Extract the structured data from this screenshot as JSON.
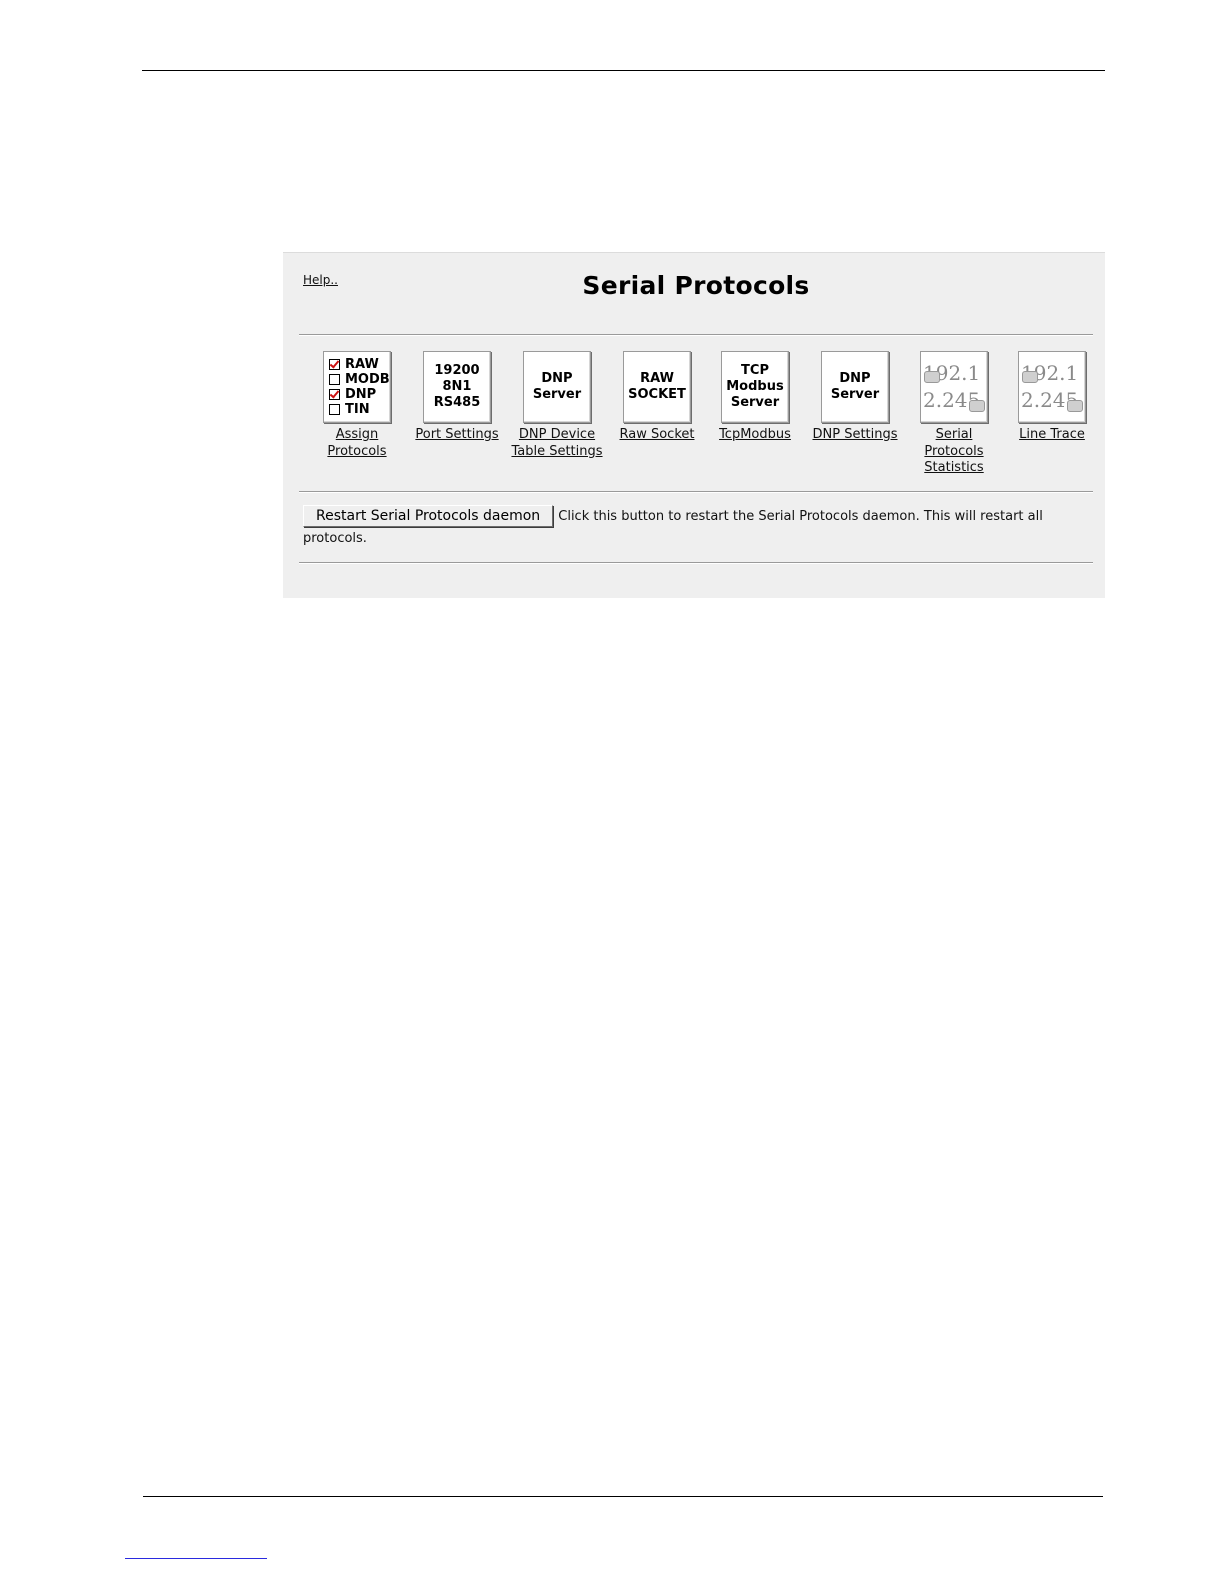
{
  "page": {
    "panel_title": "Serial Protocols",
    "help_link": "Help.."
  },
  "tiles": [
    {
      "id": "assign-protocols",
      "label": "Assign Protocols",
      "icon": "protocol-checklist-icon",
      "protocols": [
        {
          "name": "RAW",
          "checked": true
        },
        {
          "name": "MODB",
          "checked": false
        },
        {
          "name": "DNP",
          "checked": true
        },
        {
          "name": "TIN",
          "checked": false
        }
      ]
    },
    {
      "id": "port-settings",
      "label": "Port Settings",
      "icon": "port-settings-icon",
      "lines": [
        "19200",
        "8N1",
        "RS485"
      ]
    },
    {
      "id": "dnp-device-table",
      "label": "DNP Device Table Settings",
      "icon": "dnp-server-icon",
      "lines": [
        "DNP",
        "Server"
      ]
    },
    {
      "id": "raw-socket",
      "label": "Raw Socket",
      "icon": "raw-socket-icon",
      "lines": [
        "RAW",
        "SOCKET"
      ]
    },
    {
      "id": "tcpmodbus",
      "label": "TcpModbus",
      "icon": "tcp-modbus-server-icon",
      "lines": [
        "TCP",
        "Modbus",
        "Server"
      ]
    },
    {
      "id": "dnp-settings",
      "label": "DNP Settings",
      "icon": "dnp-server-icon",
      "lines": [
        "DNP",
        "Server"
      ]
    },
    {
      "id": "serial-protocols-statistics",
      "label": "Serial Protocols Statistics",
      "icon": "ip-address-icon",
      "lines": [
        "192.1",
        "2.245"
      ]
    },
    {
      "id": "line-trace",
      "label": "Line Trace",
      "icon": "ip-address-icon",
      "lines": [
        "192.1",
        "2.245"
      ]
    }
  ],
  "restart": {
    "button_label": "Restart Serial Protocols daemon",
    "description": "Click this button to restart the Serial Protocols daemon. This will restart all protocols."
  },
  "colors": {
    "panel_bg": "#efefef",
    "check_mark": "#cc1111",
    "footer_link": "#2a2adf"
  }
}
